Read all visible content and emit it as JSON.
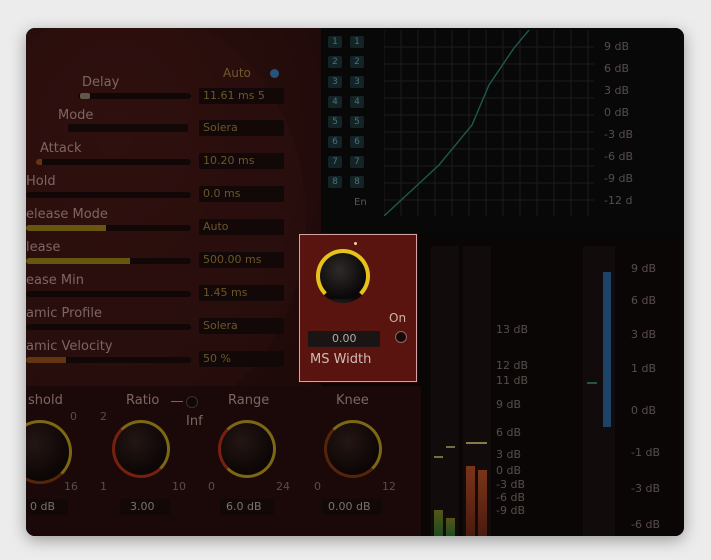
{
  "params": {
    "delay": {
      "label": "Delay",
      "value": "11.61 ms 5"
    },
    "auto_label": "Auto",
    "mode": {
      "label": "Mode",
      "value": "Solera"
    },
    "attack": {
      "label": "Attack",
      "value": "10.20 ms"
    },
    "hold": {
      "label": "Hold",
      "value": "0.0 ms"
    },
    "release_mode": {
      "label": "elease Mode",
      "value": "Auto"
    },
    "release": {
      "label": "lease",
      "value": "500.00 ms"
    },
    "release_min": {
      "label": "ease Min",
      "value": "1.45 ms"
    },
    "dynamic_profile": {
      "label": "amic Profile",
      "value": "Solera"
    },
    "dynamic_velocity": {
      "label": "amic Velocity",
      "value": "50 %"
    }
  },
  "bands": {
    "col1": [
      "1",
      "2",
      "3",
      "4",
      "5",
      "6",
      "7",
      "8"
    ],
    "col2": [
      "1",
      "2",
      "3",
      "4",
      "5",
      "6",
      "7",
      "8"
    ],
    "en_label": "En"
  },
  "graph_db": [
    "9 dB",
    "6 dB",
    "3 dB",
    "0 dB",
    "-3 dB",
    "-6 dB",
    "-9 dB",
    "-12 d"
  ],
  "knobs": {
    "threshold": {
      "label": "shold",
      "scale_max": "0",
      "scale_min": "16",
      "value": "0 dB"
    },
    "ratio": {
      "label": "Ratio",
      "scale_max": "2",
      "scale_min": "1",
      "scale_end": "10",
      "inf_label": "Inf",
      "value": "3.00"
    },
    "range": {
      "label": "Range",
      "scale_min": "0",
      "scale_end": "24",
      "value": "6.0 dB"
    },
    "knee": {
      "label": "Knee",
      "scale_min": "0",
      "scale_end": "12",
      "value": "0.00 dB"
    }
  },
  "meter_db_left": [
    "13 dB",
    "12 dB",
    "11 dB",
    "9 dB",
    "6 dB",
    "3 dB",
    "0 dB",
    "-3 dB",
    "-6 dB",
    "-9 dB"
  ],
  "meter_db_right": [
    "9 dB",
    "6 dB",
    "3 dB",
    "1 dB",
    "0 dB",
    "-1 dB",
    "-3 dB",
    "-6 dB"
  ],
  "ms_width": {
    "value": "0.00",
    "label": "MS Width",
    "on_label": "On"
  },
  "colors": {
    "accent_yellow": "#e6c31a",
    "panel_red": "#5a1410",
    "meter_blue": "#2f6fa8"
  }
}
